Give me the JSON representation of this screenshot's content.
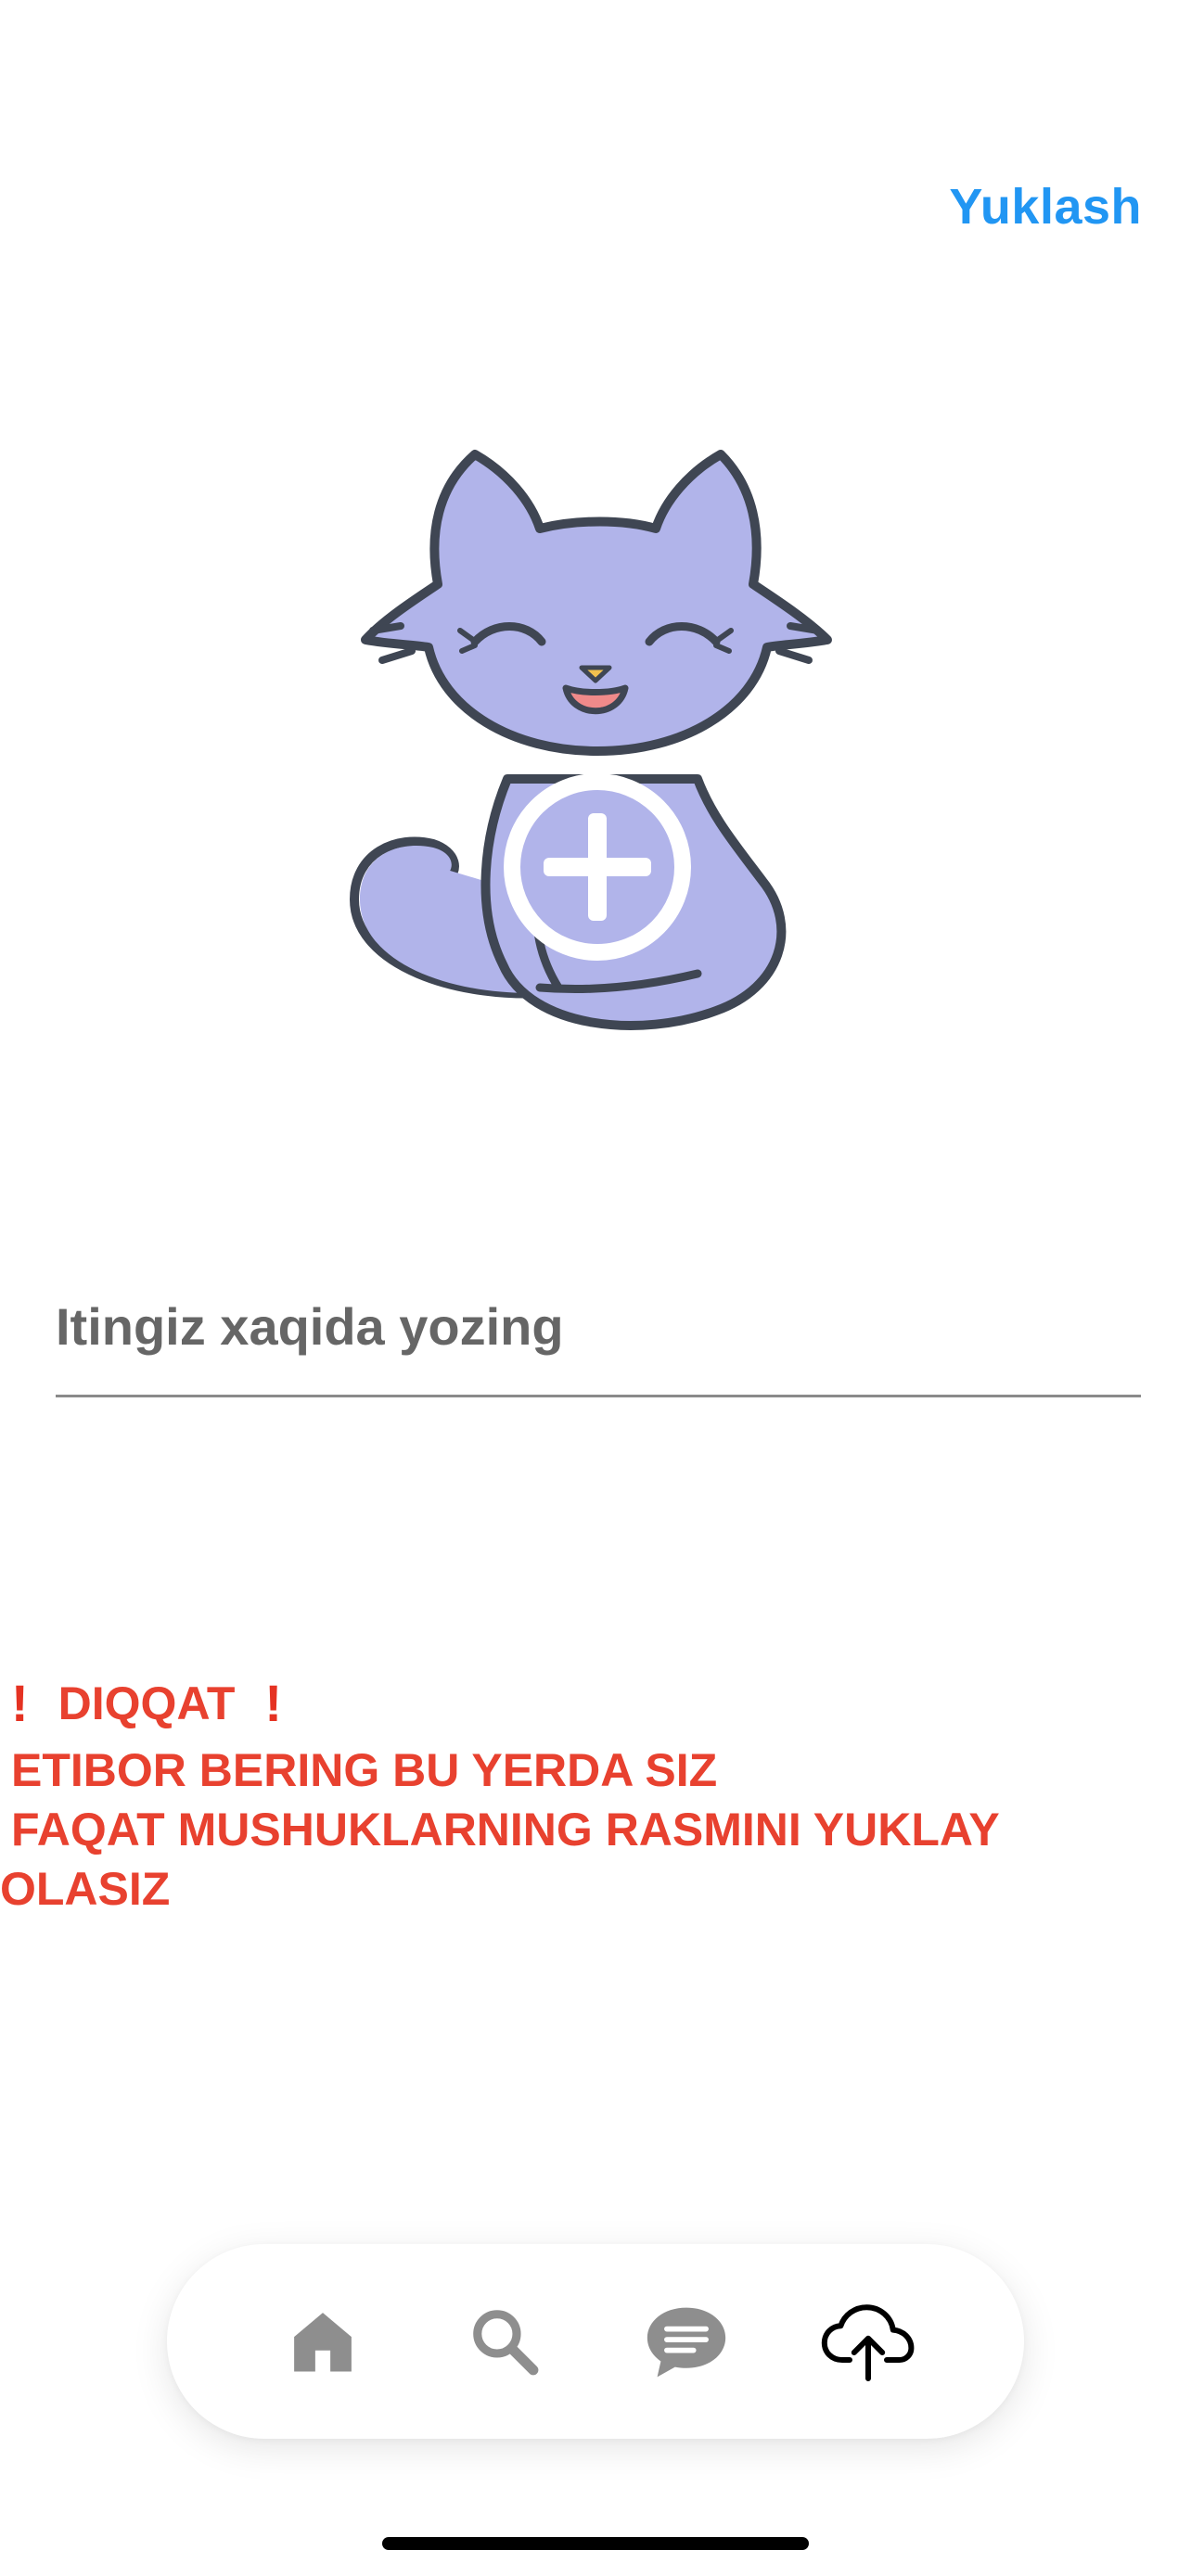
{
  "header": {
    "upload_label": "Yuklash"
  },
  "image_picker": {
    "icon": "cat-placeholder-with-plus",
    "fill_color": "#B1B4EA",
    "outline_color": "#3F4653"
  },
  "description_input": {
    "placeholder": "Itingiz xaqida yozing",
    "value": ""
  },
  "warning": {
    "exclamation": "!",
    "title": "DIQQAT",
    "line1": "ETIBOR BERING BU YERDA SIZ",
    "line2": "FAQAT MUSHUKLARNING RASMINI YUKLAY",
    "line3": "OLASIZ",
    "color": "#E8412F"
  },
  "tabbar": {
    "tabs": [
      {
        "icon": "home-icon",
        "active": false
      },
      {
        "icon": "search-icon",
        "active": false
      },
      {
        "icon": "chat-icon",
        "active": false
      },
      {
        "icon": "cloud-upload-icon",
        "active": true
      }
    ],
    "inactive_color": "#8E8E8E",
    "active_color": "#000000"
  }
}
